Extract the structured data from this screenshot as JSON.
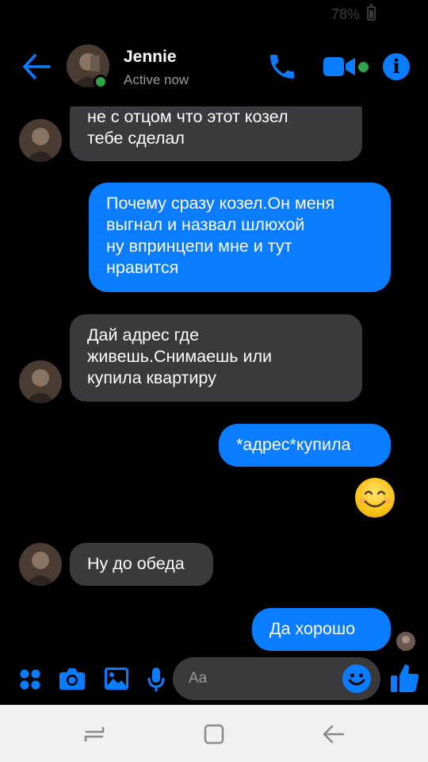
{
  "status_bar": {
    "battery": "78%"
  },
  "header": {
    "contact_name": "Jennie",
    "contact_status": "Active now"
  },
  "messages": [
    {
      "side": "incoming",
      "text": "не с отцом что этот козел\nтебе сделал"
    },
    {
      "side": "outgoing",
      "text": "Почему сразу козел.Он меня\nвыгнал и назвал шлюхой\nну впринцепи мне и тут\nнравится"
    },
    {
      "side": "incoming",
      "text": "Дай адрес где\nживешь.Снимаешь или\nкупила квартиру"
    },
    {
      "side": "outgoing",
      "text": "*адрес*купила"
    },
    {
      "side": "outgoing",
      "emoji": "smiling-face-icon"
    },
    {
      "side": "incoming",
      "text": "Ну до обеда"
    },
    {
      "side": "outgoing",
      "text": "Да хорошо"
    }
  ],
  "composer": {
    "placeholder": "Aa",
    "tools": [
      "apps-icon",
      "camera-icon",
      "gallery-icon",
      "microphone-icon"
    ],
    "send_icon": "thumbs-up-icon"
  },
  "colors": {
    "accent": "#0a7cff",
    "incoming_bubble": "#3a3a3c",
    "online": "#31a24c",
    "background": "#000000"
  },
  "nav_bar": {
    "buttons": [
      "recent-apps-icon",
      "home-icon",
      "back-icon"
    ]
  }
}
